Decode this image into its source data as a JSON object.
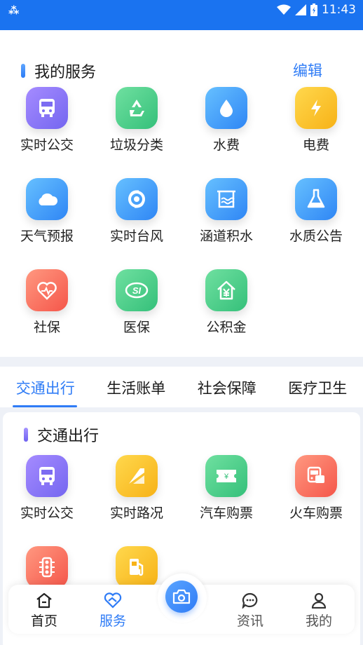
{
  "status_bar": {
    "time": "11:43"
  },
  "my_services": {
    "title": "我的服务",
    "edit_label": "编辑",
    "items": [
      {
        "label": "实时公交",
        "icon": "bus-icon"
      },
      {
        "label": "垃圾分类",
        "icon": "recycle-icon"
      },
      {
        "label": "水费",
        "icon": "water-drop-icon"
      },
      {
        "label": "电费",
        "icon": "lightning-icon"
      },
      {
        "label": "天气预报",
        "icon": "cloud-icon"
      },
      {
        "label": "实时台风",
        "icon": "typhoon-icon"
      },
      {
        "label": "涵道积水",
        "icon": "waterlogging-icon"
      },
      {
        "label": "水质公告",
        "icon": "flask-icon"
      },
      {
        "label": "社保",
        "icon": "heart-pulse-icon"
      },
      {
        "label": "医保",
        "icon": "si-icon"
      },
      {
        "label": "公积金",
        "icon": "house-yen-icon"
      }
    ]
  },
  "tabs": [
    "交通出行",
    "生活账单",
    "社会保障",
    "医疗卫生"
  ],
  "traffic_section": {
    "title": "交通出行",
    "items": [
      {
        "label": "实时公交",
        "icon": "bus-icon"
      },
      {
        "label": "实时路况",
        "icon": "road-icon"
      },
      {
        "label": "汽车购票",
        "icon": "ticket-icon"
      },
      {
        "label": "火车购票",
        "icon": "train-icon"
      },
      {
        "label": "",
        "icon": "traffic-light-icon"
      },
      {
        "label": "",
        "icon": "fuel-icon"
      }
    ]
  },
  "bottom_nav": {
    "items": [
      {
        "label": "首页",
        "icon": "home-icon"
      },
      {
        "label": "服务",
        "icon": "service-icon"
      },
      {
        "label": "资讯",
        "icon": "chat-icon"
      },
      {
        "label": "我的",
        "icon": "person-icon"
      }
    ],
    "camera_icon": "camera-icon"
  }
}
